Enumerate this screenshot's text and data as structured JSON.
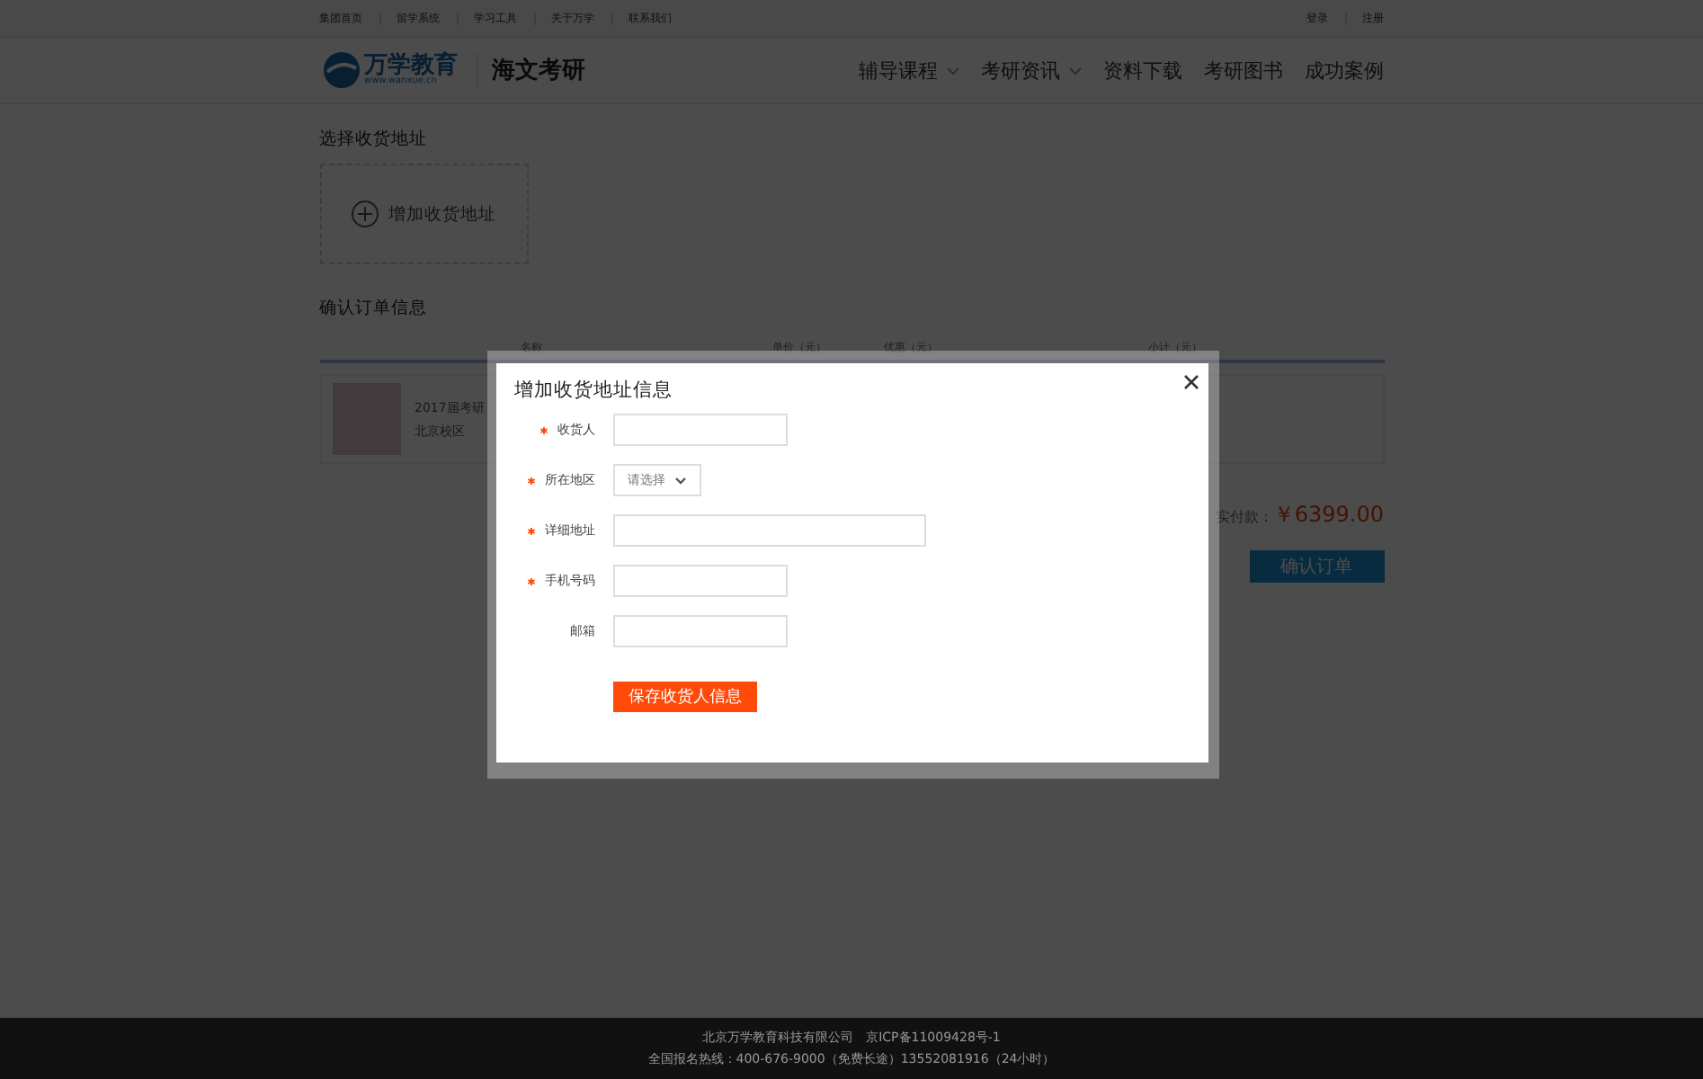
{
  "top_bar": {
    "links": [
      "集团首页",
      "留学系统",
      "学习工具",
      "关于万学",
      "联系我们"
    ],
    "auth_links": [
      "登录",
      "注册"
    ]
  },
  "header": {
    "logo_text": "万学教育",
    "logo_url": "www.wanxue.cn",
    "site_name": "海文考研",
    "nav": [
      {
        "label": "辅导课程",
        "has_dropdown": true
      },
      {
        "label": "考研资讯",
        "has_dropdown": true
      },
      {
        "label": "资料下载",
        "has_dropdown": false
      },
      {
        "label": "考研图书",
        "has_dropdown": false
      },
      {
        "label": "成功案例",
        "has_dropdown": false
      }
    ]
  },
  "address_section": {
    "title": "选择收货地址",
    "add_label": "增加收货地址"
  },
  "order_section": {
    "title": "确认订单信息",
    "columns": [
      "名称",
      "单价（元）",
      "优惠（元）",
      "小计（元）"
    ],
    "product": {
      "name": "2017届考研",
      "campus": "北京校区"
    },
    "total_label": "实付款：",
    "total_amount": "￥6399.00",
    "confirm_button": "确认订单"
  },
  "dialog": {
    "title": "增加收货地址信息",
    "fields": [
      {
        "label": "收货人",
        "required": true,
        "kind": "text",
        "wide": false
      },
      {
        "label": "所在地区",
        "required": true,
        "kind": "select",
        "placeholder": "请选择"
      },
      {
        "label": "详细地址",
        "required": true,
        "kind": "text",
        "wide": true
      },
      {
        "label": "手机号码",
        "required": true,
        "kind": "text",
        "wide": false
      },
      {
        "label": "邮箱",
        "required": false,
        "kind": "text",
        "wide": false
      }
    ],
    "save_button": "保存收货人信息"
  },
  "footer": {
    "lines": [
      "北京万学教育科技有限公司　京ICP备11009428号-1",
      "全国报名热线：400-676-9000（免费长途）13552081916（24小时）"
    ]
  }
}
